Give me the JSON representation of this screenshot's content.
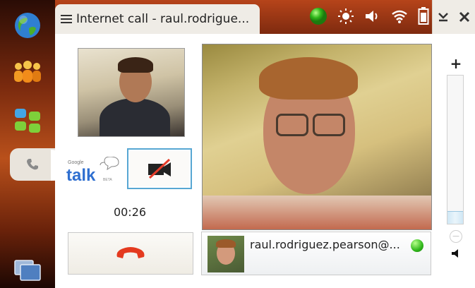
{
  "window": {
    "title": "Internet call - raul.rodrigue..."
  },
  "status": {
    "presence_color": "#2fb71a",
    "icons": [
      "presence-icon",
      "brightness-icon",
      "volume-icon",
      "wifi-icon",
      "battery-icon"
    ]
  },
  "dock": {
    "items": [
      "globe-icon",
      "contacts-icon",
      "apps-icon",
      "phone-icon",
      "task-switcher-icon"
    ],
    "active_item": "phone-icon"
  },
  "call": {
    "timer": "00:26",
    "service_logo": {
      "brand": "Google",
      "name": "talk",
      "tag": "BETA"
    },
    "video_toggle": {
      "state": "video-off"
    }
  },
  "contact": {
    "name": "raul.rodriguez.pearson@...",
    "presence_color": "#2fb71a"
  },
  "volume": {
    "level": 0.08
  }
}
